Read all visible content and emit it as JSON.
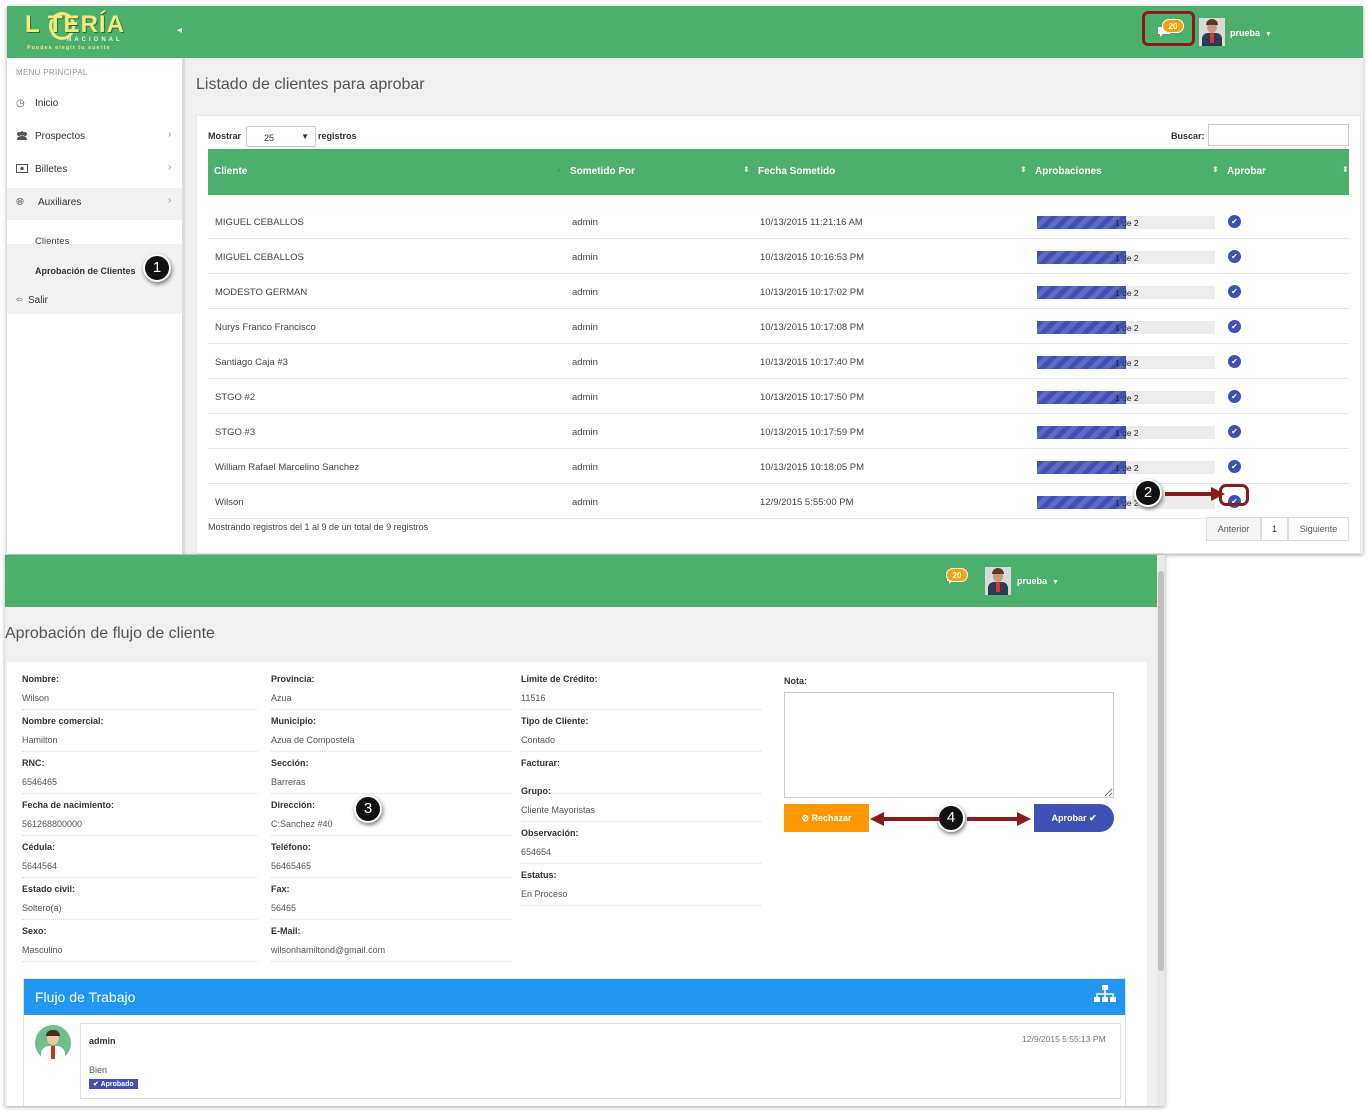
{
  "app": {
    "logo_main": "L TERÍA",
    "logo_sub1": "NACIONAL",
    "logo_sub2": "Puedes elegir tu suerte",
    "notification_count": "20",
    "user_name": "prueba"
  },
  "sidebar": {
    "title": "MENU PRINCIPAL",
    "items": [
      {
        "label": "Inicio",
        "icon": "clock-icon"
      },
      {
        "label": "Prospectos",
        "icon": "users-icon"
      },
      {
        "label": "Billetes",
        "icon": "ticket-icon"
      },
      {
        "label": "Auxiliares",
        "icon": "globe-icon"
      }
    ],
    "sub_items": [
      "Clientes",
      "Aprobación de Clientes"
    ],
    "logout": "Salir"
  },
  "list_page": {
    "title": "Listado de clientes para aprobar",
    "show_label": "Mostrar",
    "page_size": "25",
    "records_label": "registros",
    "search_label": "Buscar:",
    "search_value": "",
    "columns": [
      "Cliente",
      "Sometido Por",
      "Fecha Sometido",
      "Aprobaciones",
      "Aprobar"
    ],
    "rows": [
      {
        "cliente": "MIGUEL CEBALLOS",
        "por": "admin",
        "fecha": "10/13/2015 11:21:16 AM",
        "aprob": "1 de 2",
        "progress": 0.5
      },
      {
        "cliente": "MIGUEL CEBALLOS",
        "por": "admin",
        "fecha": "10/13/2015 10:16:53 PM",
        "aprob": "1 de 2",
        "progress": 0.5
      },
      {
        "cliente": "MODESTO GERMAN",
        "por": "admin",
        "fecha": "10/13/2015 10:17:02 PM",
        "aprob": "1 de 2",
        "progress": 0.5
      },
      {
        "cliente": "Nurys Franco Francisco",
        "por": "admin",
        "fecha": "10/13/2015 10:17:08 PM",
        "aprob": "1 de 2",
        "progress": 0.5
      },
      {
        "cliente": "Santiago Caja #3",
        "por": "admin",
        "fecha": "10/13/2015 10:17:40 PM",
        "aprob": "1 de 2",
        "progress": 0.5
      },
      {
        "cliente": "STGO #2",
        "por": "admin",
        "fecha": "10/13/2015 10:17:50 PM",
        "aprob": "1 de 2",
        "progress": 0.5
      },
      {
        "cliente": "STGO #3",
        "por": "admin",
        "fecha": "10/13/2015 10:17:59 PM",
        "aprob": "1 de 2",
        "progress": 0.5
      },
      {
        "cliente": "William Rafael Marcelino Sanchez",
        "por": "admin",
        "fecha": "10/13/2015 10:18:05 PM",
        "aprob": "1 de 2",
        "progress": 0.5
      },
      {
        "cliente": "Wilson",
        "por": "admin",
        "fecha": "12/9/2015 5:55:00 PM",
        "aprob": "1 de 2",
        "progress": 0.5
      }
    ],
    "info": "Mostrando registros del 1 al 9 de un total de 9 registros",
    "pager": {
      "prev": "Anterior",
      "page": "1",
      "next": "Siguiente"
    }
  },
  "detail_page": {
    "title": "Aprobación de flujo de cliente",
    "col1": [
      {
        "label": "Nombre:",
        "value": "Wilson"
      },
      {
        "label": "Nombre comercial:",
        "value": "Hamilton"
      },
      {
        "label": "RNC:",
        "value": "6546465"
      },
      {
        "label": "Fecha de nacimiento:",
        "value": "561268800000"
      },
      {
        "label": "Cédula:",
        "value": "5644564"
      },
      {
        "label": "Estado civil:",
        "value": "Soltero(a)"
      },
      {
        "label": "Sexo:",
        "value": "Masculino"
      }
    ],
    "col2": [
      {
        "label": "Provincia:",
        "value": "Azua"
      },
      {
        "label": "Municipio:",
        "value": "Azua de Compostela"
      },
      {
        "label": "Sección:",
        "value": "Barreras"
      },
      {
        "label": "Dirección:",
        "value": "C:Sanchez #40"
      },
      {
        "label": "Teléfono:",
        "value": "56465465"
      },
      {
        "label": "Fax:",
        "value": "56465"
      },
      {
        "label": "E-Mail:",
        "value": "wilsonhamiltond@gmail.com"
      }
    ],
    "col3": [
      {
        "label": "Limite de Crédito:",
        "value": "11516"
      },
      {
        "label": "Tipo de Cliente:",
        "value": "Contado"
      },
      {
        "label": "Facturar:",
        "value": ""
      },
      {
        "label": "Grupo:",
        "value": "Cliente Mayoristas"
      },
      {
        "label": "Observación:",
        "value": "654654"
      },
      {
        "label": "Estatus:",
        "value": "En Proceso"
      }
    ],
    "nota_label": "Nota:",
    "nota_value": "",
    "reject_label": "Rechazar",
    "approve_label": "Aprobar",
    "workflow": {
      "title": "Flujo de Trabajo",
      "user": "admin",
      "timestamp": "12/9/2015 5:55:13 PM",
      "comment": "Bien",
      "status": "Aprobado"
    }
  },
  "callouts": [
    "1",
    "2",
    "3",
    "4"
  ],
  "colors": {
    "topbar": "#4caf6c",
    "primary": "#3f51b5",
    "reject": "#ff9800",
    "workflow": "#2196f3",
    "callout_border": "#8b0000"
  }
}
